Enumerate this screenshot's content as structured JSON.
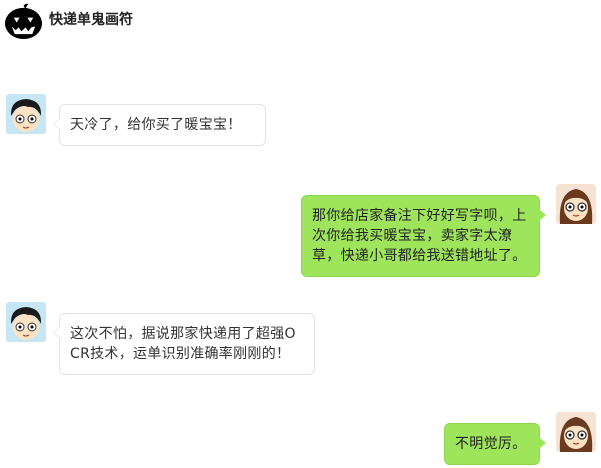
{
  "header": {
    "title": "快递单鬼画符",
    "logo_icon": "pumpkin-icon"
  },
  "colors": {
    "sent_bubble": "#9ee55b",
    "received_bubble": "#ffffff"
  },
  "messages": [
    {
      "side": "left",
      "avatar_icon": "boy-avatar-icon",
      "text": "天冷了，给你买了暖宝宝！"
    },
    {
      "side": "right",
      "avatar_icon": "girl-avatar-icon",
      "text": "那你给店家备注下好好写字呗，上次你给我买暖宝宝，卖家字太潦草，快递小哥都给我送错地址了。"
    },
    {
      "side": "left",
      "avatar_icon": "boy-avatar-icon",
      "text": "这次不怕，据说那家快递用了超强OCR技术，运单识别准确率刚刚的！"
    },
    {
      "side": "right",
      "avatar_icon": "girl-avatar-icon",
      "text": "不明觉厉。"
    }
  ]
}
